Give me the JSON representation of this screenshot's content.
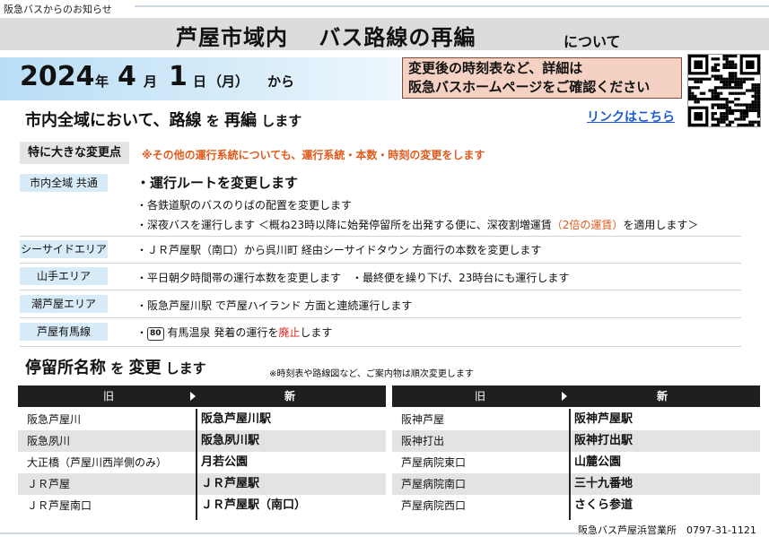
{
  "header": {
    "source_note": "阪急バスからのお知らせ",
    "title_main": "芦屋市域内　 バス路線の再編",
    "title_sub": "について"
  },
  "date": {
    "year": "2024",
    "year_unit": "年",
    "month": "4",
    "month_unit": "月",
    "day": "1",
    "day_unit": "日",
    "weekday": "（月）",
    "from": "から"
  },
  "notice": {
    "line1": "変更後の時刻表など、詳細は",
    "line2": "阪急バスホームページをご確認ください"
  },
  "qr_code": {
    "icon": "qr-code"
  },
  "section1": {
    "part1": "市内全域において、路線",
    "part2": " を ",
    "part3": "再編",
    "part4": " します",
    "link": "リンクはこちら"
  },
  "major_change": {
    "label": "特に大きな変更点",
    "warning": "※その他の運行系統についても、運行系統・本数・時刻の変更をします"
  },
  "areas": [
    {
      "label": "市内全域 共通",
      "lines": [
        "・運行ルートを変更します",
        "・各鉄道駅のバスのりばの配置を変更します",
        "・深夜バスを運行します ＜概ね23時以降に始発停留所を出発する便に、深夜割増運賃",
        "（2倍の運賃）",
        "を適用します＞"
      ]
    },
    {
      "label": "シーサイドエリア",
      "lines": [
        "・ＪＲ芦屋駅（南口）から呉川町 経由シーサイドタウン 方面行の本数を変更します"
      ]
    },
    {
      "label": "山手エリア",
      "lines": [
        "・平日朝夕時間帯の運行本数を変更します　・最終便を繰り下げ、23時台にも運行します"
      ]
    },
    {
      "label": "潮芦屋エリア",
      "lines": [
        "・阪急芦屋川駅 で芦屋ハイランド 方面と連続運行します"
      ]
    },
    {
      "label": "芦屋有馬線",
      "lines": [
        "・",
        "80",
        "有馬温泉 発着の運行を",
        "廃止",
        "します"
      ]
    }
  ],
  "section2": {
    "part1": "停留所名称",
    "part2": " を ",
    "part3": "変更",
    "part4": " します",
    "note": "※時刻表や路線図など、ご案内物は順次変更します"
  },
  "table": {
    "old_header": "旧",
    "new_header": "新",
    "left": [
      {
        "old": "阪急芦屋川",
        "new": "阪急芦屋川駅"
      },
      {
        "old": "阪急夙川",
        "new": "阪急夙川駅"
      },
      {
        "old": "大正橋（芦屋川西岸側のみ）",
        "new": "月若公園"
      },
      {
        "old": "ＪＲ芦屋",
        "new": "ＪＲ芦屋駅"
      },
      {
        "old": "ＪＲ芦屋南口",
        "new": "ＪＲ芦屋駅（南口）"
      }
    ],
    "right": [
      {
        "old": "阪神芦屋",
        "new": "阪神芦屋駅"
      },
      {
        "old": "阪神打出",
        "new": "阪神打出駅"
      },
      {
        "old": "芦屋病院東口",
        "new": "山麓公園"
      },
      {
        "old": "芦屋病院南口",
        "new": "三十九番地"
      },
      {
        "old": "芦屋病院西口",
        "new": "さくら参道"
      }
    ]
  },
  "footer": {
    "text": "阪急バス芦屋浜営業所　0797-31-1121"
  },
  "colors": {
    "accent_orange": "#e05a1c",
    "notice_bg": "#f5d1c3",
    "badge_bg": "#d7ebf8",
    "link": "#1a5ad6"
  }
}
